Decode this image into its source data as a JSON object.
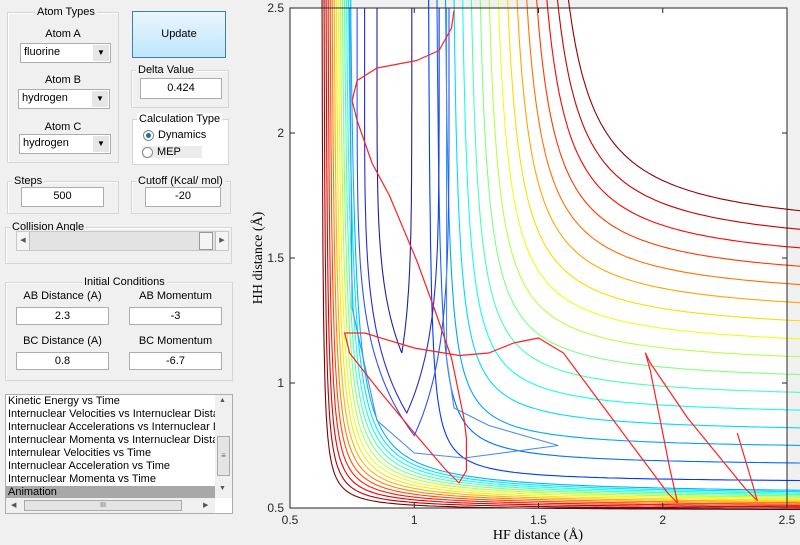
{
  "atom_types": {
    "title": "Atom Types",
    "atom_a_label": "Atom A",
    "atom_a": "fluorine",
    "atom_b_label": "Atom B",
    "atom_b": "hydrogen",
    "atom_c_label": "Atom C",
    "atom_c": "hydrogen"
  },
  "update_label": "Update",
  "delta": {
    "title": "Delta Value",
    "value": "0.424"
  },
  "calc_type": {
    "title": "Calculation Type",
    "options": [
      "Dynamics",
      "MEP"
    ],
    "selected": "Dynamics"
  },
  "steps": {
    "title": "Steps",
    "value": "500"
  },
  "cutoff": {
    "title": "Cutoff (Kcal/ mol)",
    "value": "-20"
  },
  "collision_angle": {
    "title": "Collision Angle",
    "slider_value": 0.97
  },
  "initial": {
    "title": "Initial Conditions",
    "ab_dist_label": "AB Distance (A)",
    "ab_dist": "2.3",
    "ab_mom_label": "AB Momentum",
    "ab_mom": "-3",
    "bc_dist_label": "BC Distance (A)",
    "bc_dist": "0.8",
    "bc_mom_label": "BC Momentum",
    "bc_mom": "-6.7"
  },
  "plot_list": {
    "items": [
      "Kinetic Energy vs Time",
      "Internuclear Velocities vs Internuclear Distance",
      "Internuclear Accelerations vs Internuclear Distance",
      "Internuclear Momenta vs Internuclear Distance",
      "Internulear Velocities vs Time",
      "Internuclear Acceleration vs Time",
      "Internuclear Momenta vs Time",
      "Animation"
    ],
    "selected": 7,
    "hscroll_label": "III"
  },
  "chart_data": {
    "type": "contour",
    "xlabel": "HF distance (Å)",
    "ylabel": "HH distance (Å)",
    "xlim": [
      0.5,
      2.5
    ],
    "ylim": [
      0.5,
      2.5
    ],
    "xticks": [
      "0.5",
      "1",
      "1.5",
      "2",
      "2.5"
    ],
    "yticks": [
      "0.5",
      "1",
      "1.5",
      "2",
      "2.5"
    ],
    "colormap": "jet",
    "trajectory_color": "#ff2020",
    "trajectory": [
      [
        2.3,
        0.8
      ],
      [
        2.36,
        0.6
      ],
      [
        2.38,
        0.53
      ],
      [
        2.33,
        0.58
      ],
      [
        2.1,
        0.86
      ],
      [
        1.95,
        1.08
      ],
      [
        1.93,
        1.12
      ],
      [
        1.95,
        1.05
      ],
      [
        2.03,
        0.65
      ],
      [
        2.06,
        0.52
      ],
      [
        2.02,
        0.56
      ],
      [
        1.75,
        0.92
      ],
      [
        1.6,
        1.12
      ],
      [
        1.5,
        1.18
      ],
      [
        1.4,
        1.16
      ],
      [
        1.3,
        1.12
      ],
      [
        1.18,
        1.11
      ],
      [
        1.0,
        1.14
      ],
      [
        0.8,
        1.2
      ],
      [
        0.72,
        1.2
      ],
      [
        0.74,
        1.12
      ],
      [
        0.85,
        0.98
      ],
      [
        1.0,
        0.8
      ],
      [
        1.12,
        0.66
      ],
      [
        1.18,
        0.6
      ],
      [
        1.21,
        0.65
      ],
      [
        1.21,
        0.78
      ],
      [
        1.2,
        0.86
      ],
      [
        1.15,
        1.1
      ],
      [
        1.08,
        1.3
      ],
      [
        1.01,
        1.49
      ],
      [
        0.9,
        1.75
      ],
      [
        0.83,
        1.88
      ],
      [
        0.77,
        2.05
      ],
      [
        0.75,
        2.13
      ],
      [
        0.77,
        2.21
      ],
      [
        0.85,
        2.26
      ],
      [
        1.01,
        2.29
      ],
      [
        1.1,
        2.33
      ],
      [
        1.15,
        2.42
      ],
      [
        1.16,
        2.49
      ]
    ]
  }
}
